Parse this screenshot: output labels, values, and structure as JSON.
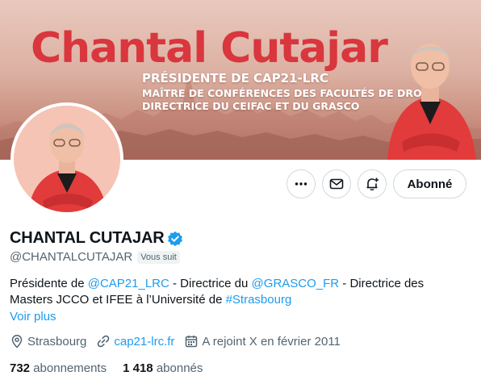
{
  "banner": {
    "title": "Chantal Cutajar",
    "line1": "PRÉSIDENTE DE CAP21-LRC",
    "line2": "MAÎTRE DE CONFÉRENCES DES FACULTÉS DE DROIT",
    "line3": "DIRECTRICE DU CEIFAC ET DU GRASCO",
    "title_color": "#d9363e"
  },
  "actions": {
    "more_icon": "more-dots-icon",
    "mail_icon": "envelope-icon",
    "notify_icon": "bell-plus-icon",
    "follow_label": "Abonné"
  },
  "profile": {
    "name": "CHANTAL CUTAJAR",
    "verified_icon": "verified-badge-icon",
    "verified_color": "#1d9bf0",
    "handle": "@CHANTALCUTAJAR",
    "follows_you": "Vous suit",
    "bio": {
      "t1": "Présidente de ",
      "l1": "@CAP21_LRC",
      "t2": " - Directrice du ",
      "l2": "@GRASCO_FR",
      "t3": " -   Directrice des Masters JCCO et IFEE à l’Université de ",
      "l3": "#Strasbourg"
    },
    "see_more": "Voir plus",
    "location": "Strasbourg",
    "website": "cap21-lrc.fr",
    "joined": "A rejoint X en février 2011",
    "following_count": "732",
    "following_label": "abonnements",
    "followers_count": "1 418",
    "followers_label": "abonnés",
    "link_color": "#1d9bf0"
  }
}
